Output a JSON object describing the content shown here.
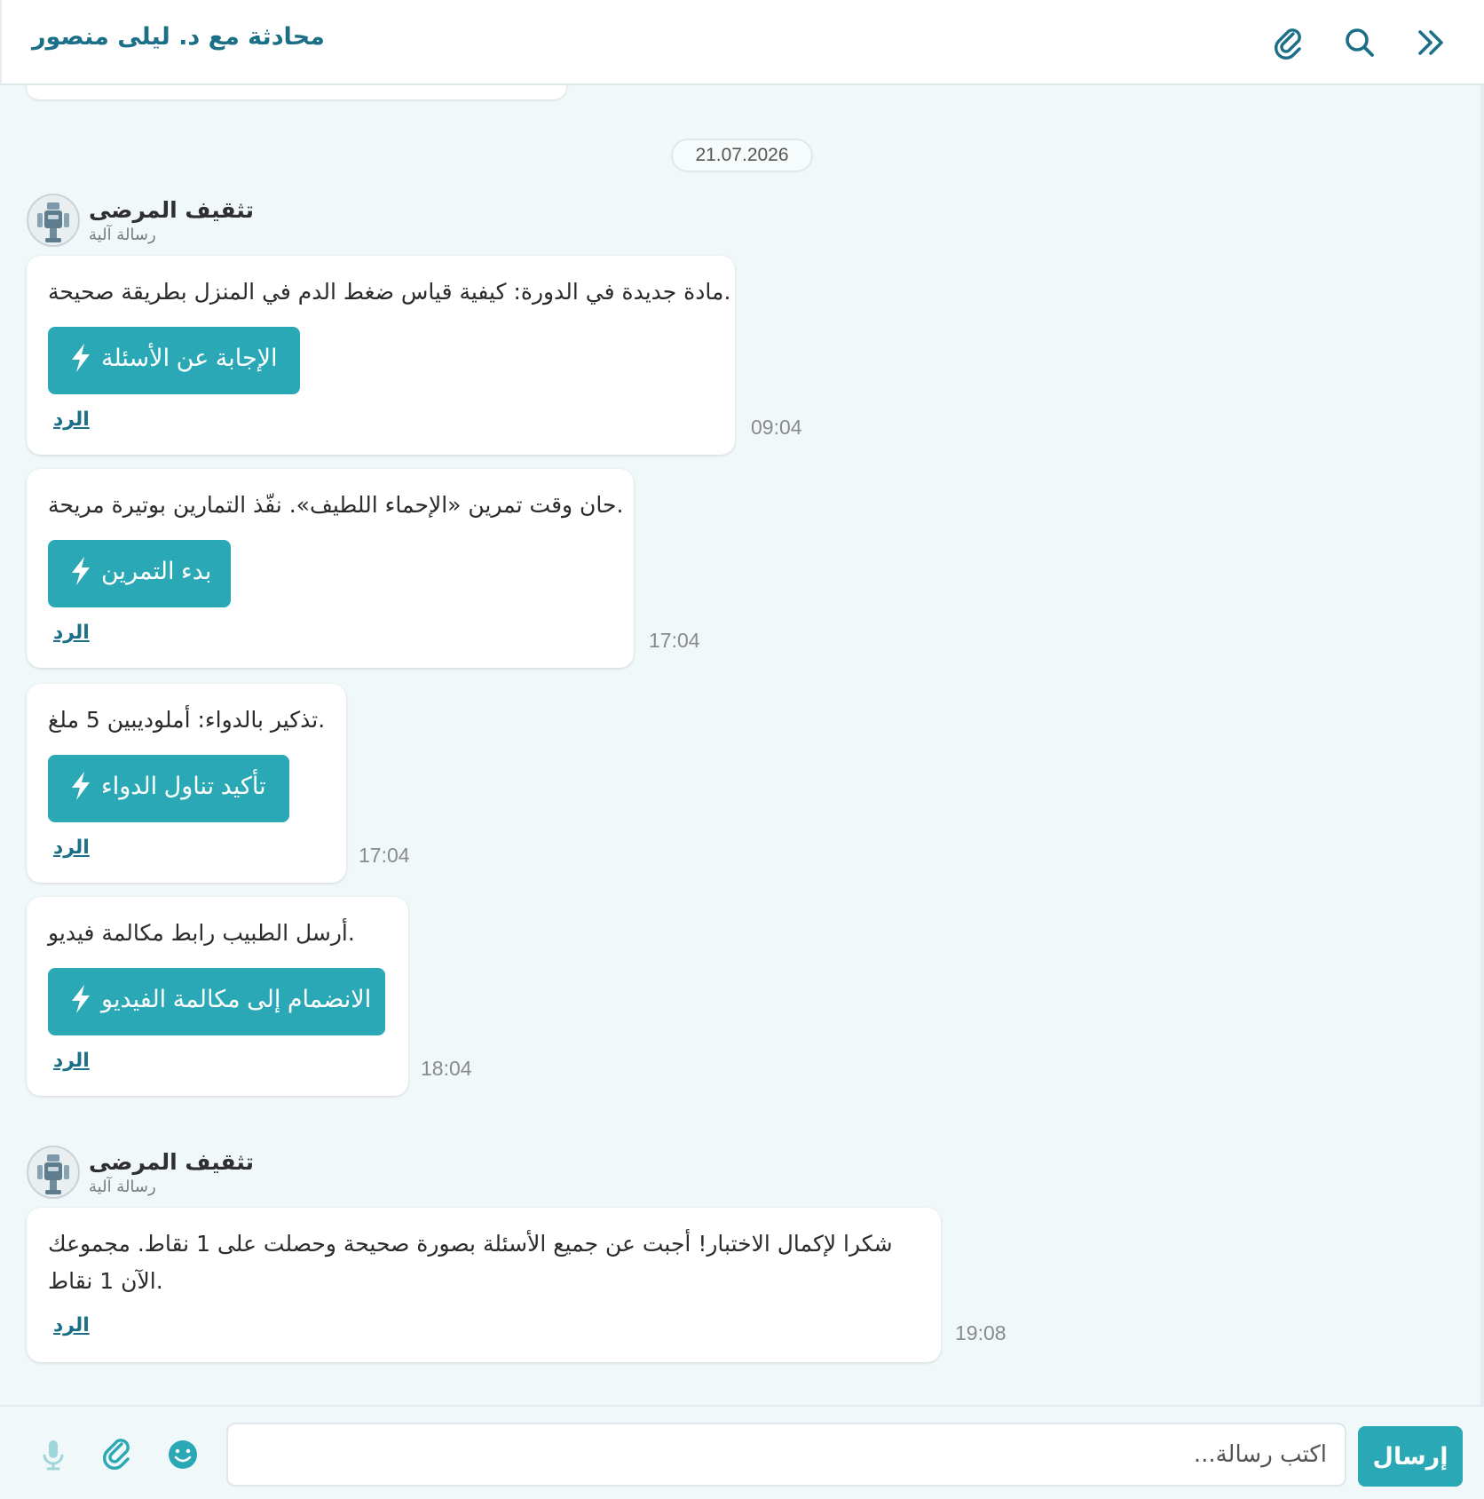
{
  "header": {
    "title": "محادثة مع د. ليلى منصور",
    "icons": [
      "attachment-icon",
      "search-icon",
      "double-chevron-right-icon"
    ]
  },
  "chat": {
    "date_divider": "21.07.2026",
    "groups": [
      {
        "sender": "تثقيف المرضى",
        "sender_sub": "رسالة آلية",
        "messages": [
          {
            "text": "مادة جديدة في الدورة: كيفية قياس ضغط الدم في المنزل بطريقة صحيحة.",
            "button": "الإجابة عن الأسئلة",
            "reply": "الرد",
            "time": "09:04"
          },
          {
            "text": "حان وقت تمرين «الإحماء اللطيف». نفّذ التمارين بوتيرة مريحة.",
            "button": "بدء التمرين",
            "reply": "الرد",
            "time": "17:04"
          },
          {
            "text": "تذكير بالدواء: أملوديبين 5 ملغ.",
            "button": "تأكيد تناول الدواء",
            "reply": "الرد",
            "time": "17:04"
          },
          {
            "text": "أرسل الطبيب رابط مكالمة فيديو.",
            "button": "الانضمام إلى مكالمة الفيديو",
            "reply": "الرد",
            "time": "18:04"
          }
        ]
      },
      {
        "sender": "تثقيف المرضى",
        "sender_sub": "رسالة آلية",
        "messages": [
          {
            "text": "شكرا لإكمال الاختبار! أجبت عن جميع الأسئلة بصورة صحيحة وحصلت على 1 نقاط. مجموعك الآن 1 نقاط.",
            "reply": "الرد",
            "time": "19:08"
          }
        ]
      }
    ]
  },
  "composer": {
    "placeholder": "اكتب رسالة...",
    "send_label": "إرسال",
    "icons": [
      "microphone-icon",
      "attachment-icon",
      "emoji-icon"
    ]
  },
  "colors": {
    "accent": "#2aa8b5",
    "title": "#1b6f86",
    "chat_background": "#f1f8fa"
  }
}
